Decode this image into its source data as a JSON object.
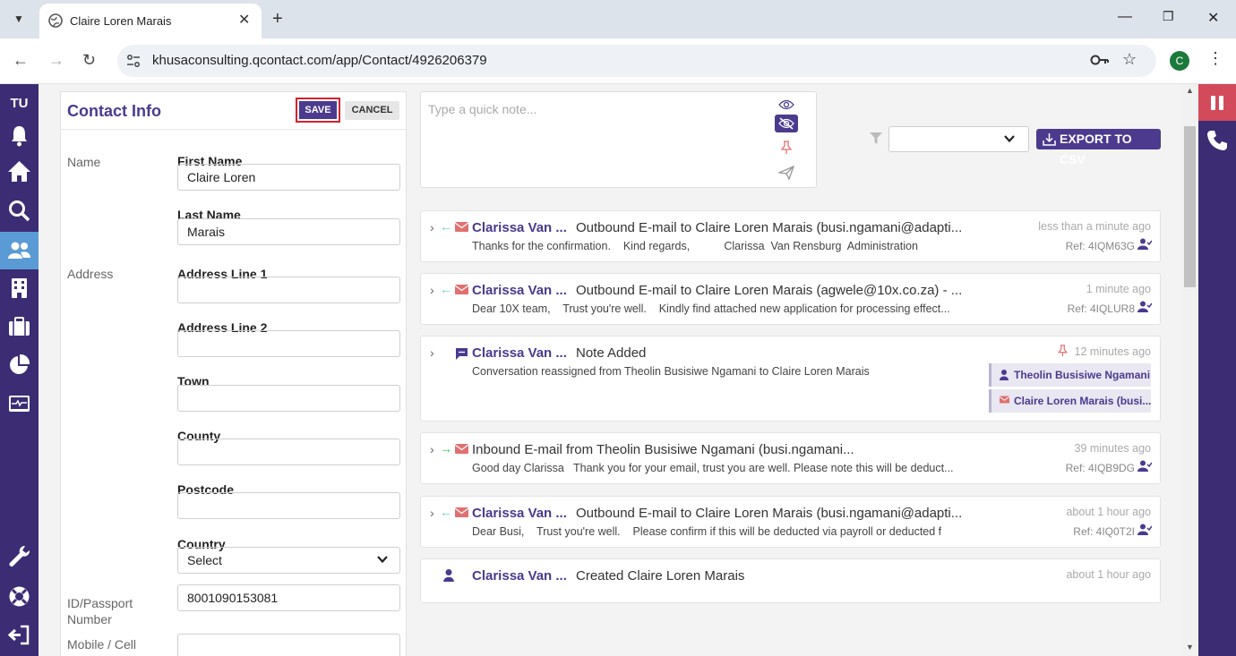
{
  "browser": {
    "tab_title": "Claire Loren Marais",
    "url": "khusaconsulting.qcontact.com/app/Contact/4926206379",
    "profile_initial": "C"
  },
  "sidebar": {
    "user_initials": "TU",
    "items": [
      "bell-icon",
      "home-icon",
      "search-icon",
      "contacts-icon",
      "building-icon",
      "briefcase-icon",
      "pie-chart-icon",
      "monitor-icon",
      "wrench-icon",
      "lifebuoy-icon",
      "logout-icon"
    ]
  },
  "contact": {
    "title": "Contact Info",
    "save_label": "SAVE",
    "cancel_label": "CANCEL",
    "name_group": "Name",
    "address_group": "Address",
    "first_name_label": "First Name",
    "first_name_value": "Claire Loren",
    "last_name_label": "Last Name",
    "last_name_value": "Marais",
    "addr1_label": "Address Line 1",
    "addr1_value": "",
    "addr2_label": "Address Line 2",
    "addr2_value": "",
    "town_label": "Town",
    "town_value": "",
    "county_label": "County",
    "county_value": "",
    "postcode_label": "Postcode",
    "postcode_value": "",
    "country_label": "Country",
    "country_value": "Select",
    "id_label": "ID/Passport Number",
    "id_value": "8001090153081",
    "mobile_label": "Mobile / Cell",
    "mobile_value": ""
  },
  "note": {
    "placeholder": "Type a quick note..."
  },
  "filter": {
    "selected": "",
    "export_label": "EXPORT TO CSV"
  },
  "colors": {
    "brand": "#4b3a8e",
    "sidebar": "#3b2c74",
    "email_icon": "#e07070",
    "inbound_arrow": "#2ecc40",
    "outbound_arrow": "#5fd3c7",
    "highlight": "#d0242e"
  },
  "activities": [
    {
      "who": "Clarissa Van ...",
      "subject": "Outbound E-mail to Claire Loren Marais (busi.ngamani@adapti...",
      "preview": "Thanks for the confirmation.    Kind regards,           Clarissa  Van Rensburg  Administration",
      "time": "less than a minute ago",
      "ref": "Ref: 4IQM63G"
    },
    {
      "who": "Clarissa Van ...",
      "subject": "Outbound E-mail to Claire Loren Marais (agwele@10x.co.za) - ...",
      "preview": "Dear 10X team,    Trust you're well.    Kindly find attached new application for processing effect...",
      "time": "1 minute ago",
      "ref": "Ref: 4IQLUR8"
    },
    {
      "who": "Clarissa Van ...",
      "subject": "Note Added",
      "preview": "Conversation reassigned from Theolin Busisiwe Ngamani to Claire Loren Marais",
      "time": "12 minutes ago",
      "tags": [
        "Theolin Busisiwe Ngamani",
        "Claire Loren Marais (busi..."
      ]
    },
    {
      "subject": "Inbound E-mail from Theolin Busisiwe Ngamani (busi.ngamani...",
      "preview": "Good day Clarissa   Thank you for your email, trust you are well. Please note this will be deduct...",
      "time": "39 minutes ago",
      "ref": "Ref: 4IQB9DG"
    },
    {
      "who": "Clarissa Van ...",
      "subject": "Outbound E-mail to Claire Loren Marais (busi.ngamani@adapti...",
      "preview": "Dear Busi,    Trust you're well.    Please confirm if this will be deducted via payroll or deducted f",
      "time": "about 1 hour ago",
      "ref": "Ref: 4IQ0T2I"
    },
    {
      "who": "Clarissa Van ...",
      "subject": "Created Claire Loren Marais",
      "time": "about 1 hour ago"
    }
  ]
}
